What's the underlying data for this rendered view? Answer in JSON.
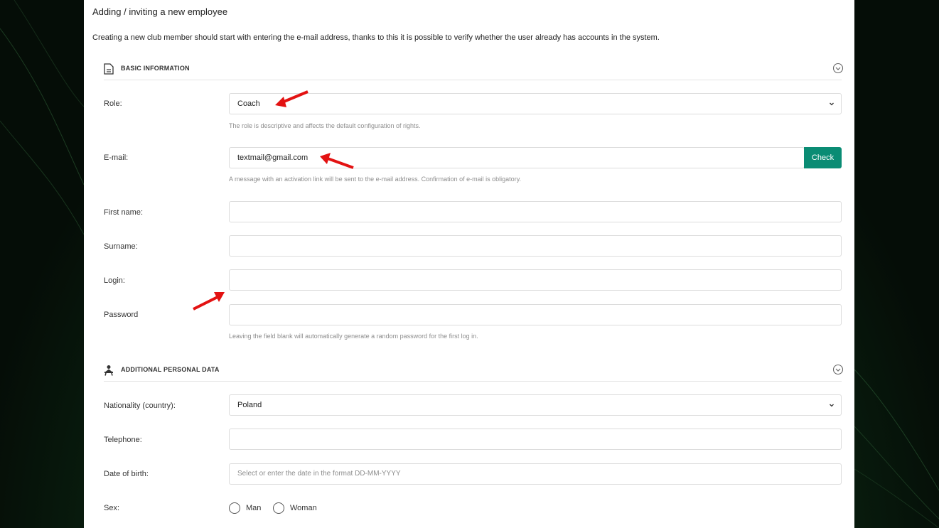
{
  "page": {
    "title": "Adding / inviting a new employee",
    "intro": "Creating a new club member should start with entering the e-mail address, thanks to this it is possible to verify whether the user already has accounts in the system."
  },
  "basic": {
    "title": "BASIC INFORMATION",
    "role_label": "Role:",
    "role_value": "Coach",
    "role_help": "The role is descriptive and affects the default configuration of rights.",
    "email_label": "E-mail:",
    "email_value": "textmail@gmail.com",
    "check_label": "Check",
    "email_help": "A message with an activation link will be sent to the e-mail address. Confirmation of e-mail is obligatory.",
    "first_name_label": "First name:",
    "surname_label": "Surname:",
    "login_label": "Login:",
    "password_label": "Password",
    "password_help": "Leaving the field blank will automatically generate a random password for the first log in."
  },
  "additional": {
    "title": "ADDITIONAL PERSONAL DATA",
    "nationality_label": "Nationality (country):",
    "nationality_value": "Poland",
    "telephone_label": "Telephone:",
    "dob_label": "Date of birth:",
    "dob_placeholder": "Select or enter the date in the format DD-MM-YYYY",
    "sex_label": "Sex:",
    "sex_options": [
      "Man",
      "Woman"
    ]
  },
  "icons": {
    "basic_section": "document-icon",
    "additional_section": "person-desk-icon",
    "collapse": "chevron-circle-icon",
    "select": "chevron-down-icon",
    "annotation": "red-arrow-icon"
  },
  "colors": {
    "accent": "#0a8c74",
    "annotation_arrow": "#e31212"
  }
}
